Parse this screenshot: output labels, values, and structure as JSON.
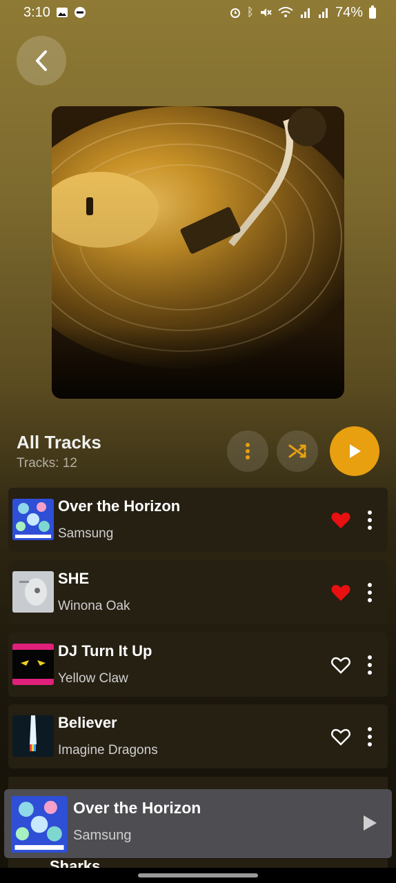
{
  "status_bar": {
    "time": "3:10",
    "battery": "74%",
    "left_icons": [
      "image-icon",
      "do-not-disturb-icon"
    ],
    "right_icons": [
      "alarm-icon",
      "bluetooth-icon",
      "mute-icon",
      "wifi-icon",
      "signal-icon",
      "signal-icon",
      "battery-icon"
    ]
  },
  "header": {
    "back_icon": "chevron-left-icon",
    "cover_icon": "turntable-record-image"
  },
  "playlist": {
    "title": "All Tracks",
    "count_label": "Tracks: 12",
    "buttons": {
      "more": "more-vertical-icon",
      "shuffle": "shuffle-icon",
      "play": "play-icon"
    }
  },
  "colors": {
    "accent": "#e8a010",
    "liked": "#e81010",
    "card": "#262013",
    "mini_player": "#4d4d52"
  },
  "tracks": [
    {
      "title": "Over the Horizon",
      "artist": "Samsung",
      "liked": true
    },
    {
      "title": "SHE",
      "artist": "Winona Oak",
      "liked": true
    },
    {
      "title": "DJ Turn It Up",
      "artist": "Yellow Claw",
      "liked": false
    },
    {
      "title": "Believer",
      "artist": "Imagine Dragons",
      "liked": false
    }
  ],
  "peek_track": {
    "title": "Sharks"
  },
  "now_playing": {
    "title": "Over the Horizon",
    "artist": "Samsung"
  }
}
